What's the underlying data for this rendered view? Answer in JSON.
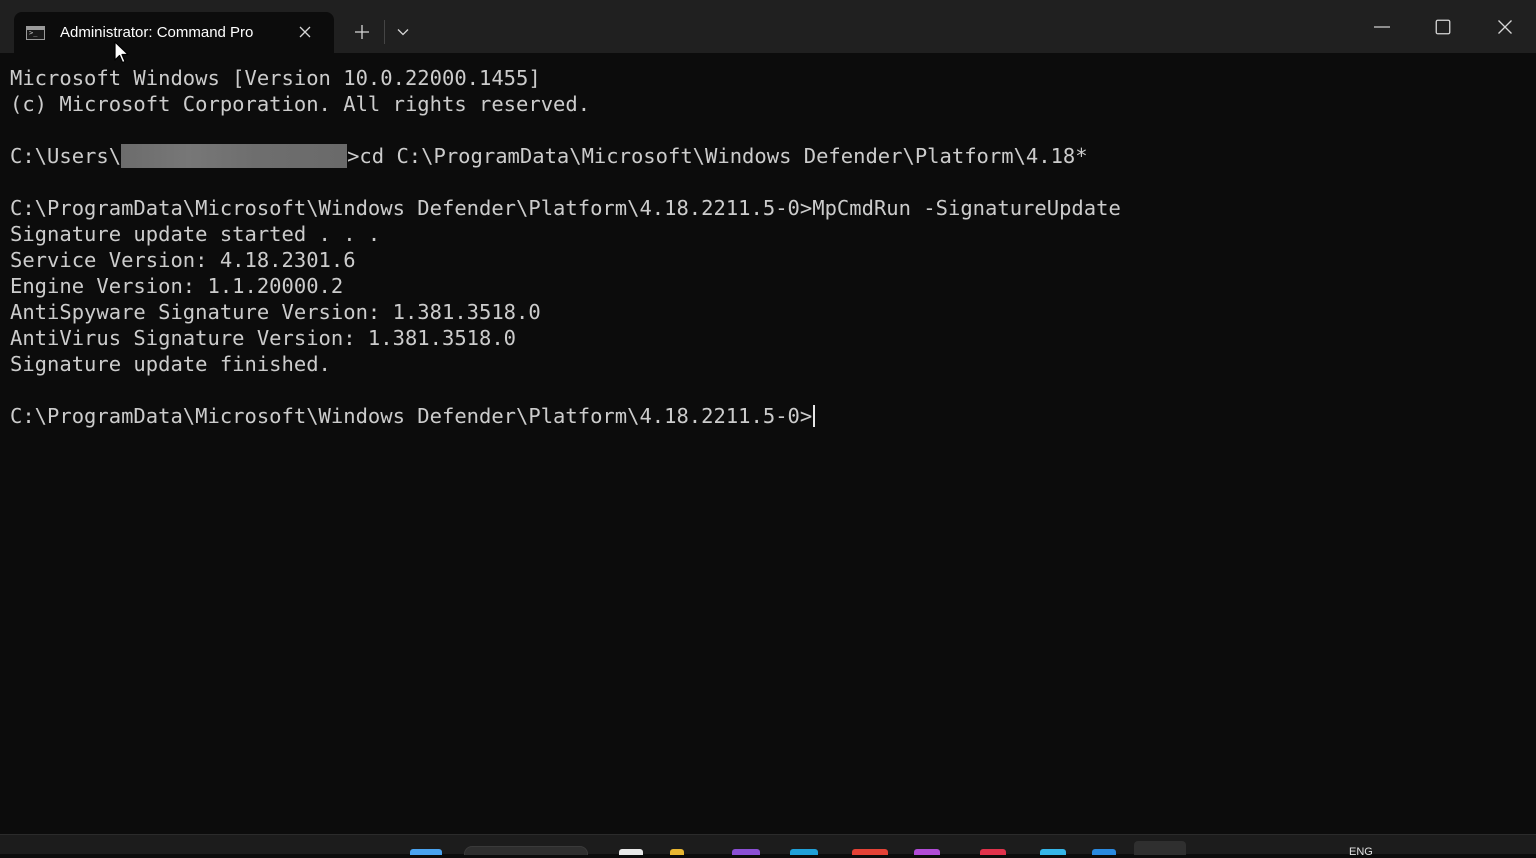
{
  "window": {
    "tab_title": "Administrator: Command Pro",
    "tab_icon": "command-prompt-icon",
    "controls": {
      "close_tab_icon": "close-icon",
      "new_tab_icon": "plus-icon",
      "dropdown_icon": "chevron-down-icon",
      "minimize_icon": "minimize-icon",
      "maximize_icon": "maximize-icon",
      "close_window_icon": "close-icon"
    }
  },
  "console": {
    "lines": [
      "Microsoft Windows [Version 10.0.22000.1455]",
      "(c) Microsoft Corporation. All rights reserved.",
      "",
      "",
      "",
      "C:\\ProgramData\\Microsoft\\Windows Defender\\Platform\\4.18.2211.5-0>MpCmdRun -SignatureUpdate",
      "Signature update started . . .",
      "Service Version: 4.18.2301.6",
      "Engine Version: 1.1.20000.2",
      "AntiSpyware Signature Version: 1.381.3518.0",
      "AntiVirus Signature Version: 1.381.3518.0",
      "Signature update finished.",
      "",
      "C:\\ProgramData\\Microsoft\\Windows Defender\\Platform\\4.18.2211.5-0>"
    ],
    "cd_prefix": "C:\\Users\\",
    "cd_command": ">cd C:\\ProgramData\\Microsoft\\Windows Defender\\Platform\\4.18*"
  },
  "taskbar": {
    "language": "ENG"
  },
  "colors": {
    "console_bg": "#0c0c0c",
    "console_text": "#cccccc",
    "titlebar_bg": "#202020"
  }
}
